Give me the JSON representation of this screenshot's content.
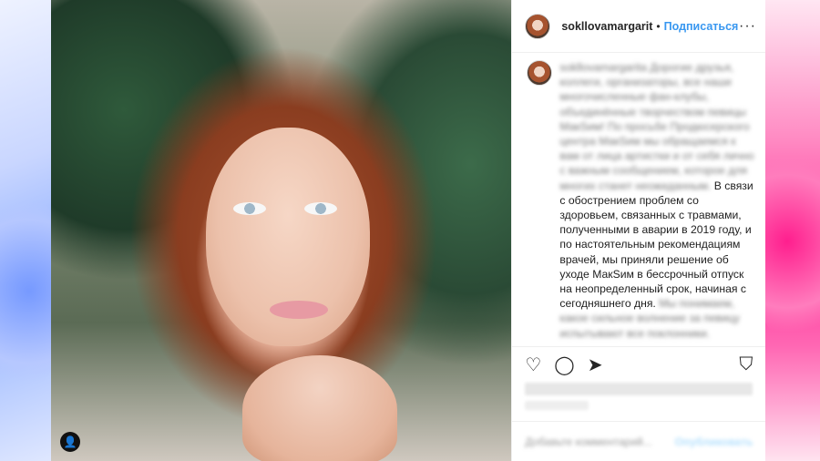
{
  "header": {
    "username": "sokllovamargarit",
    "separator": "•",
    "follow_label": "Подписаться",
    "more_label": "···"
  },
  "caption": {
    "username_blurred": "sokllovamargarita",
    "blurred_lead": "Дорогие друзья, коллеги, организаторы, все наши многочисленные фан-клубы, объединённые творчеством певицы МакSим! По просьбе Продюсерского центра МакSим мы обращаемся к вам от лица артистки и от себя лично с важным сообщением, которое для многих станет неожиданным.",
    "visible_first": "В",
    "visible_text": "связи с обострением проблем со здоровьем, связанных с травмами, полученными в аварии в 2019 году, и по настоятельным рекомендациям врачей, мы приняли решение об уходе МакSим в бессрочный отпуск на неопределенный срок, начиная с сегодняшнего дня.",
    "blurred_tail": "Мы понимаем, какое сильное волнение за певицу испытывают все поклонники."
  },
  "actions": {
    "like_icon": "♡",
    "comment_icon": "◯",
    "share_icon": "➤",
    "save_icon": "⛉"
  },
  "comment": {
    "placeholder": "Добавьте комментарий...",
    "publish_label": "Опубликовать"
  },
  "photo": {
    "badge_icon": "👤"
  }
}
